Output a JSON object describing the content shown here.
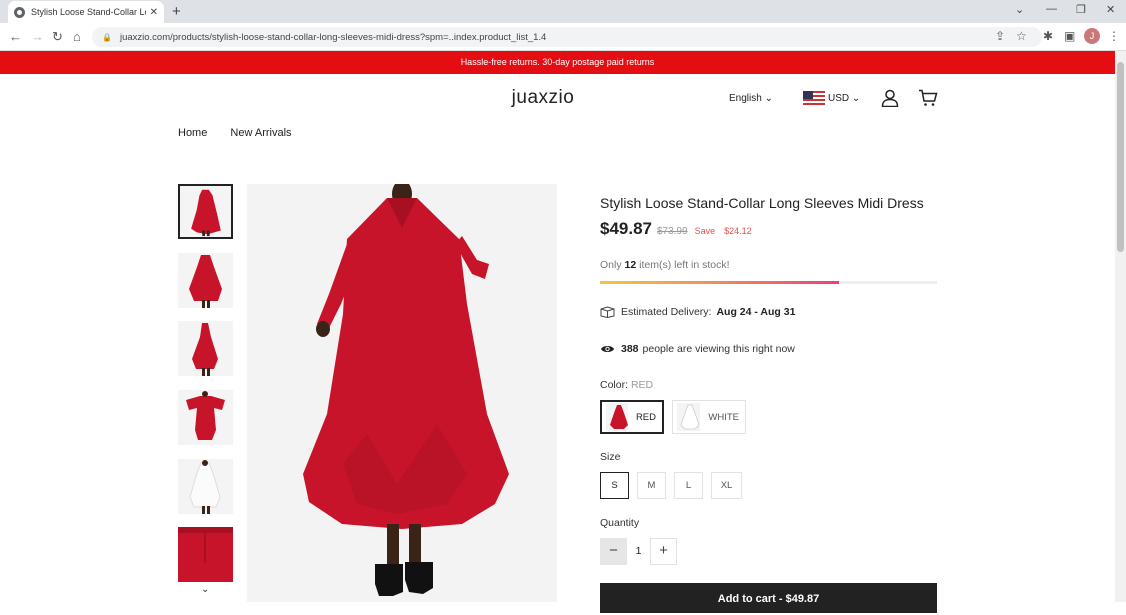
{
  "browser": {
    "tab_title": "Stylish Loose Stand-Collar Long Sleeves Midi Dress",
    "url": "juaxzio.com/products/stylish-loose-stand-collar-long-sleeves-midi-dress?spm=..index.product_list_1.4"
  },
  "announcement": "Hassle-free returns. 30-day postage paid returns",
  "header": {
    "logo": "juaxzio",
    "language": "English",
    "currency": "USD"
  },
  "nav": {
    "items": [
      "Home",
      "New Arrivals"
    ]
  },
  "product": {
    "title": "Stylish Loose Stand-Collar Long Sleeves Midi Dress",
    "price": "$49.87",
    "old_price": "$73.99",
    "save_label": "Save",
    "save_amount": "$24.12",
    "stock_prefix": "Only",
    "stock_count": "12",
    "stock_suffix": "item(s) left in stock!",
    "stock_level": 0.71,
    "delivery_label": "Estimated Delivery:",
    "delivery_dates": "Aug 24 - Aug 31",
    "viewing_count": "388",
    "viewing_text": "people are viewing this right now",
    "color_label": "Color:",
    "color_selected": "RED",
    "colors": [
      "RED",
      "WHITE"
    ],
    "size_label": "Size",
    "sizes": [
      "S",
      "M",
      "L",
      "XL"
    ],
    "quantity_label": "Quantity",
    "quantity": "1",
    "add_to_cart": "Add to cart - $49.87"
  },
  "colors": {
    "announcement_bg": "#e30d12",
    "dress_red": "#c8142a",
    "save_red": "#e84f4f"
  }
}
